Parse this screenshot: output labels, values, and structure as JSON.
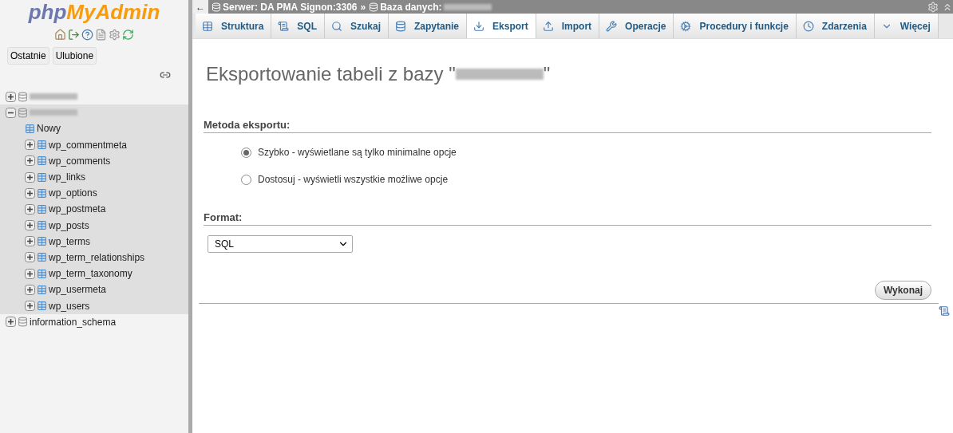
{
  "sidebar": {
    "logo": {
      "php": "php",
      "rest": "MyAdmin"
    },
    "buttons": [
      "Ostatnie",
      "Ulubione"
    ],
    "tree": [
      {
        "kind": "db",
        "blurred": true,
        "expanded": false,
        "selected": false
      },
      {
        "kind": "db",
        "blurred": true,
        "expanded": true,
        "selected": true,
        "children": [
          {
            "kind": "new",
            "name": "Nowy"
          },
          {
            "kind": "table",
            "name": "wp_commentmeta"
          },
          {
            "kind": "table",
            "name": "wp_comments"
          },
          {
            "kind": "table",
            "name": "wp_links"
          },
          {
            "kind": "table",
            "name": "wp_options"
          },
          {
            "kind": "table",
            "name": "wp_postmeta"
          },
          {
            "kind": "table",
            "name": "wp_posts"
          },
          {
            "kind": "table",
            "name": "wp_terms"
          },
          {
            "kind": "table",
            "name": "wp_term_relationships"
          },
          {
            "kind": "table",
            "name": "wp_term_taxonomy"
          },
          {
            "kind": "table",
            "name": "wp_usermeta"
          },
          {
            "kind": "table",
            "name": "wp_users"
          }
        ]
      },
      {
        "kind": "db",
        "name": "information_schema",
        "blurred": false,
        "expanded": false,
        "selected": false
      }
    ]
  },
  "breadcrumb": {
    "back": "←",
    "server": "Serwer: DA PMA Signon:3306",
    "separator": "»",
    "database_label": "Baza danych:"
  },
  "tabs": [
    {
      "label": "Struktura",
      "selected": false
    },
    {
      "label": "SQL",
      "selected": false
    },
    {
      "label": "Szukaj",
      "selected": false
    },
    {
      "label": "Zapytanie",
      "selected": false
    },
    {
      "label": "Eksport",
      "selected": true
    },
    {
      "label": "Import",
      "selected": false
    },
    {
      "label": "Operacje",
      "selected": false
    },
    {
      "label": "Procedury i funkcje",
      "selected": false
    },
    {
      "label": "Zdarzenia",
      "selected": false
    },
    {
      "label": "Więcej",
      "selected": false
    }
  ],
  "page": {
    "title_prefix": "Eksportowanie tabeli z bazy \"",
    "title_suffix": "\"",
    "method_heading": "Metoda eksportu:",
    "methods": [
      {
        "label": "Szybko - wyświetlane są tylko minimalne opcje",
        "selected": true
      },
      {
        "label": "Dostosuj - wyświetli wszystkie możliwe opcje",
        "selected": false
      }
    ],
    "format_heading": "Format:",
    "format_value": "SQL",
    "submit": "Wykonaj"
  }
}
